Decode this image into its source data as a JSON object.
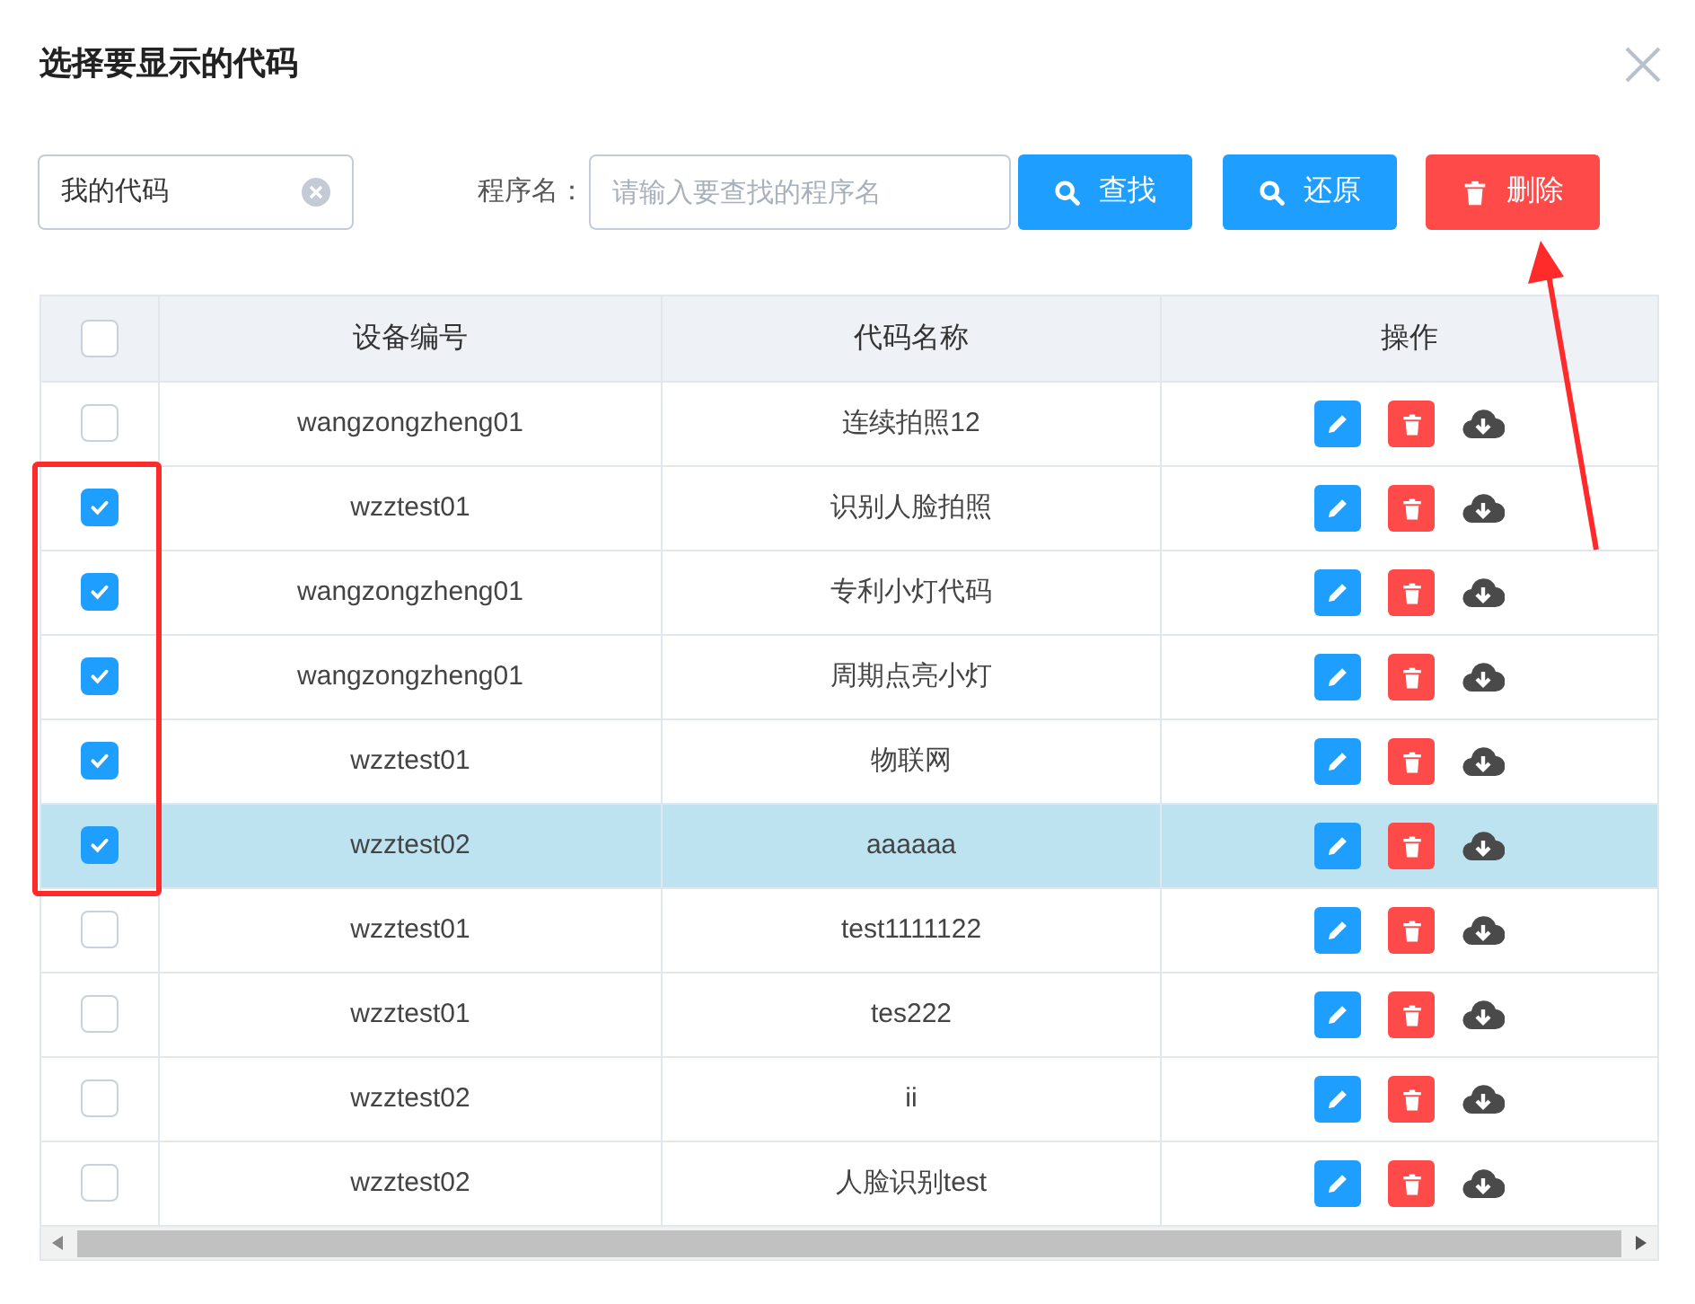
{
  "dialog": {
    "title": "选择要显示的代码"
  },
  "filter": {
    "source_value": "我的代码",
    "program_label": "程序名：",
    "program_placeholder": "请输入要查找的程序名"
  },
  "buttons": [
    {
      "kind": "search",
      "label": "查找"
    },
    {
      "kind": "search",
      "label": "还原"
    },
    {
      "kind": "delete",
      "label": "删除"
    }
  ],
  "table": {
    "all_checked": false,
    "columns": [
      "设备编号",
      "代码名称",
      "操作"
    ],
    "rows": [
      {
        "device": "wangzongzheng01",
        "name": "连续拍照12",
        "checked": false,
        "highlighted": false
      },
      {
        "device": "wzztest01",
        "name": "识别人脸拍照",
        "checked": true,
        "highlighted": false
      },
      {
        "device": "wangzongzheng01",
        "name": "专利小灯代码",
        "checked": true,
        "highlighted": false
      },
      {
        "device": "wangzongzheng01",
        "name": "周期点亮小灯",
        "checked": true,
        "highlighted": false
      },
      {
        "device": "wzztest01",
        "name": "物联网",
        "checked": true,
        "highlighted": false
      },
      {
        "device": "wzztest02",
        "name": "aaaaaa",
        "checked": true,
        "highlighted": true
      },
      {
        "device": "wzztest01",
        "name": "test1111122",
        "checked": false,
        "highlighted": false
      },
      {
        "device": "wzztest01",
        "name": "tes222",
        "checked": false,
        "highlighted": false
      },
      {
        "device": "wzztest02",
        "name": "ii",
        "checked": false,
        "highlighted": false
      },
      {
        "device": "wzztest02",
        "name": "人脸识别test",
        "checked": false,
        "highlighted": false
      }
    ]
  }
}
